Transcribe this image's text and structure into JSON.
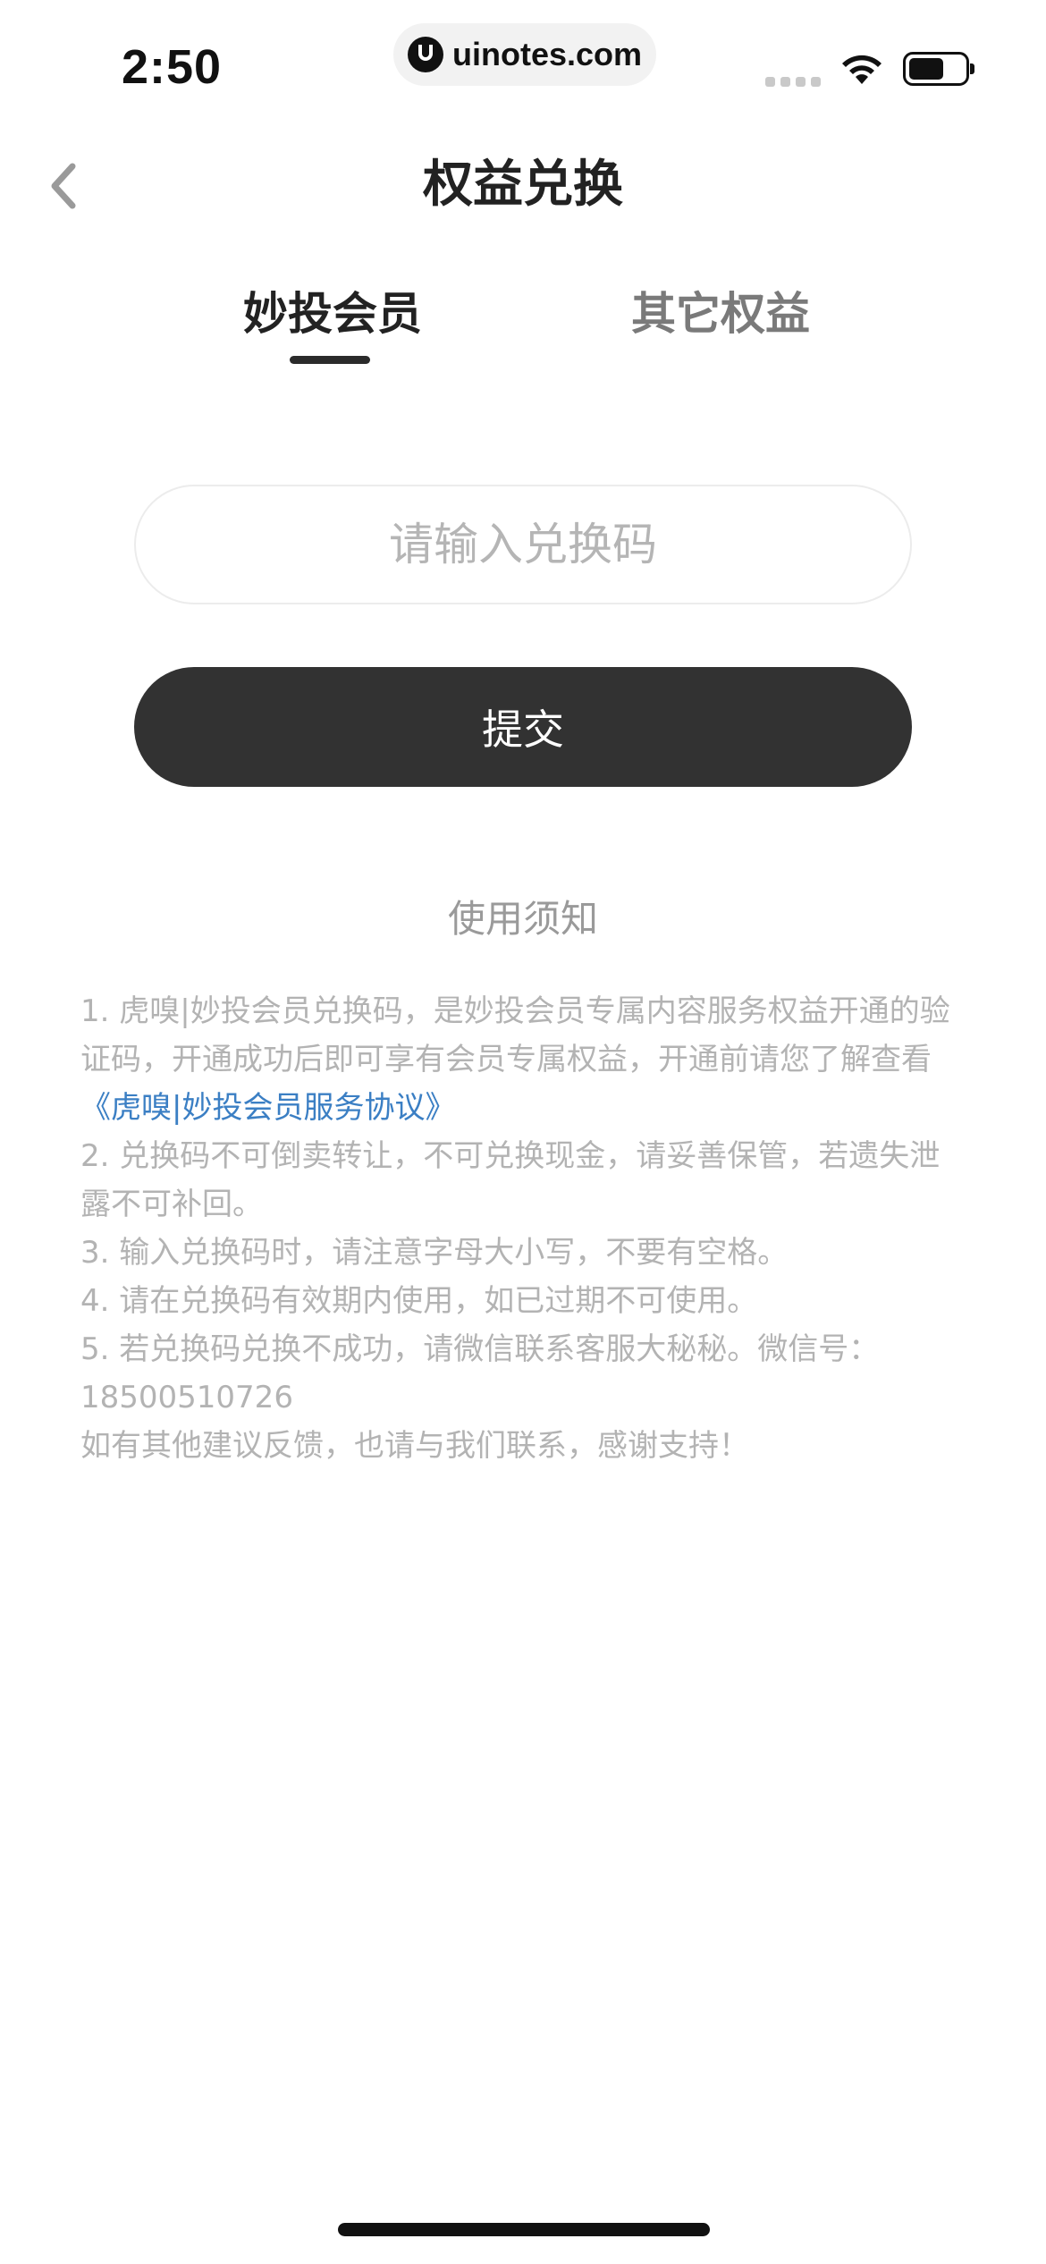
{
  "status_bar": {
    "time": "2:50",
    "url": "uinotes.com"
  },
  "nav": {
    "title": "权益兑换"
  },
  "tabs": [
    {
      "label": "妙投会员",
      "active": true
    },
    {
      "label": "其它权益",
      "active": false
    }
  ],
  "redeem": {
    "input_placeholder": "请输入兑换码",
    "input_value": "",
    "submit_label": "提交"
  },
  "notice": {
    "title": "使用须知",
    "item1_before_link": "1. 虎嗅|妙投会员兑换码，是妙投会员专属内容服务权益开通的验证码，开通成功后即可享有会员专属权益，开通前请您了解查看",
    "item1_link": "《虎嗅|妙投会员服务协议》",
    "item2": "2. 兑换码不可倒卖转让，不可兑换现金，请妥善保管，若遗失泄露不可补回。",
    "item3": "3. 输入兑换码时，请注意字母大小写，不要有空格。",
    "item4": "4. 请在兑换码有效期内使用，如已过期不可使用。",
    "item5": "5. 若兑换码兑换不成功，请微信联系客服大秘秘。微信号：18500510726",
    "closing": "如有其他建议反馈，也请与我们联系，感谢支持！"
  },
  "colors": {
    "primary_button": "#323232",
    "link": "#3b7fc4",
    "muted_text": "#b3b3b3"
  }
}
